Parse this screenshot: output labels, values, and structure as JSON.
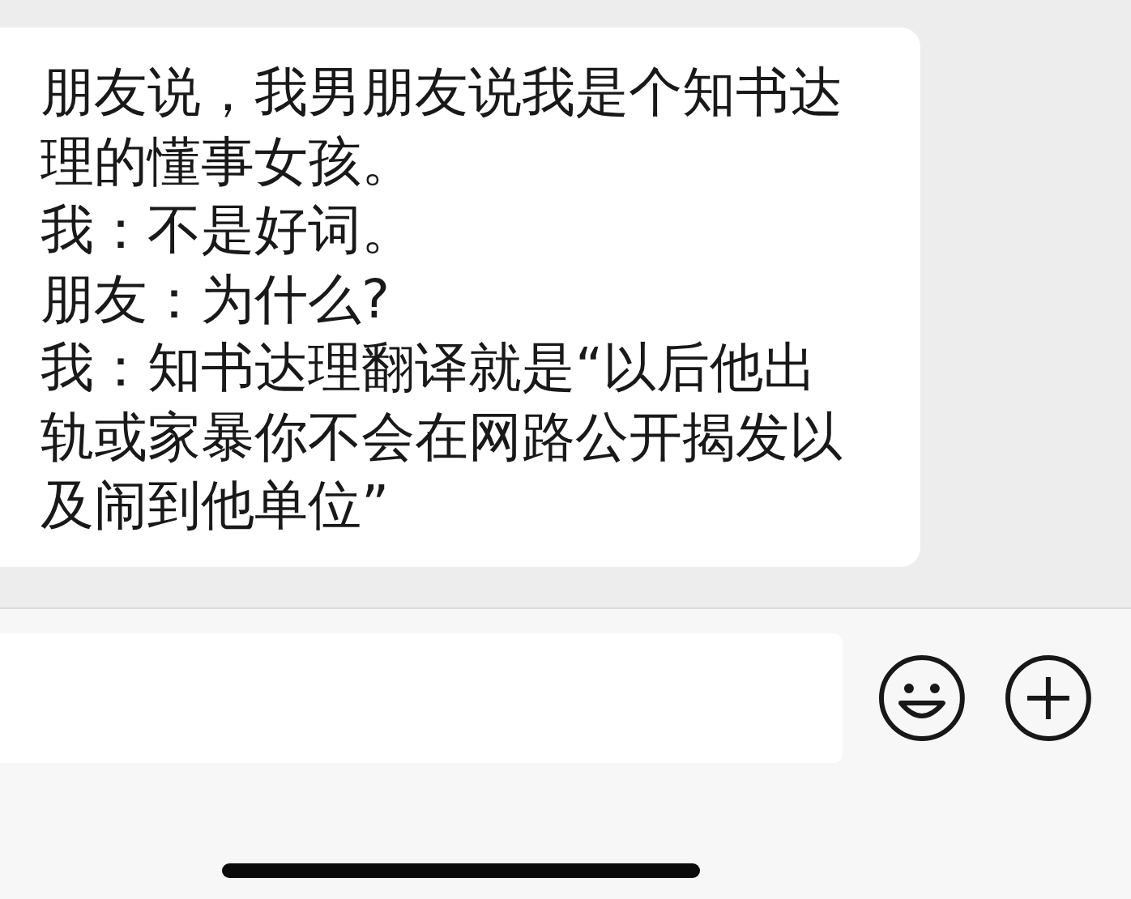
{
  "message": {
    "paragraphs": [
      "朋友说，我男朋友说我是个知书达理的懂事女孩。",
      "我：不是好词。",
      "朋友：为什么?",
      "我：知书达理翻译就是“以后他出轨或家暴你不会在网路公开揭发以及闹到他单位”"
    ]
  }
}
